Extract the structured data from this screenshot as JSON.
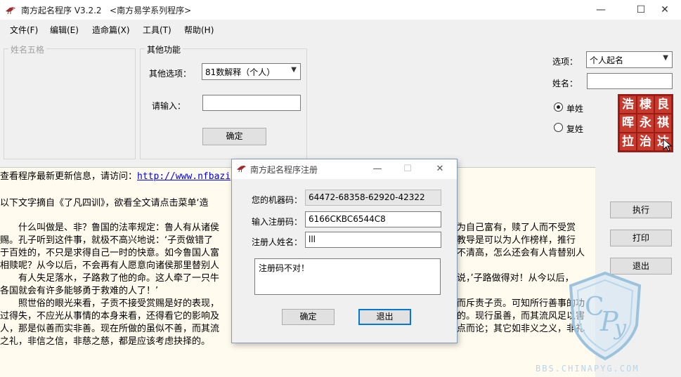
{
  "window": {
    "title": "南方起名程序 V3.2.2",
    "subtitle": "<南方易学系列程序>",
    "minimize": "—",
    "maximize": "☐",
    "close": "✕"
  },
  "menu": [
    "文件(F)",
    "编辑(E)",
    "造命篇(X)",
    "工具(T)",
    "帮助(H)"
  ],
  "name_five_grid": {
    "label": "姓名五格"
  },
  "other_functions": {
    "label": "其他功能",
    "option_label": "其他选项：",
    "option_value": "81数解释（个人）",
    "input_label": "请输入：",
    "input_value": "",
    "confirm": "确定"
  },
  "right_panel": {
    "option_label": "选项：",
    "option_value": "个人起名",
    "surname_label": "姓名：",
    "surname_value": "",
    "single_surname": "单姓",
    "compound_surname": "复姓",
    "single_checked": true,
    "seal_chars": [
      "浩",
      "棣",
      "良",
      "晖",
      "永",
      "祺",
      "拉",
      "治",
      "达"
    ],
    "run": "执行",
    "print": "打印",
    "exit": "退出"
  },
  "content": {
    "lines": [
      {
        "text": "查看程序最新更新信息，请访问：",
        "link": "http://www.nfbazi"
      },
      {
        "text": "以下文字摘自《了凡四训》，欲看全文请点击菜单‘造"
      },
      {
        "text": "　　什么叫做是、非？鲁国的法率规定：鲁人有从诸侯",
        "tail": "为自己富有，赎了人而不受赏"
      },
      {
        "text": "赐。孔子听到这件事，就极不高兴地说：‘子贡做错了",
        "tail": "教导是可以为人作榜样，推行"
      },
      {
        "text": "于百姓的，不只是求得自己一时的快意。如今鲁国人富",
        "tail": "不清高，怎么还会有人肯替别人"
      },
      {
        "text": "相赎呢？从今以后，不会再有人愿意向诸侯那里替别人"
      },
      {
        "text": "　　有人失足落水，子路救了他的命。这人牵了一只牛",
        "tail": "说，’子路做得对！从今以后，"
      },
      {
        "text": "各国就会有许多能够勇于救难的人了！’"
      },
      {
        "text": "　　照世俗的眼光来看，子贡不接受赏赐是好的表现，",
        "tail": "而斥责子贡。可知所行善事的功"
      },
      {
        "text": "过得失，不应光从事情的本身来看，还得看它的影响及",
        "tail": "的。现行虽善，而其流风足以害"
      },
      {
        "text": "人，那是似善而实非善。现在所做的虽似不善，而其流",
        "tail": "点而论；其它如非义之义，非礼"
      },
      {
        "text": "之礼，非信之信，非慈之慈，都是应该考虑抉择的。"
      }
    ]
  },
  "watermark": {
    "text": "BBS.CHINAPYG.COM",
    "logo_letters": "CPY"
  },
  "dialog": {
    "title": "南方起名程序注册",
    "machine_code_label": "您的机器码：",
    "machine_code": "64472-68358-62920-42322",
    "reg_code_label": "输入注册码：",
    "reg_code": "6166CKBC6544C8",
    "reg_name_label": "注册人姓名：",
    "reg_name": "lll",
    "message": "注册码不对！",
    "ok": "确定",
    "exit": "退出"
  },
  "colors": {
    "seal_dark": "#9b1c16",
    "seal_light": "#c63b2e",
    "text_area_bg": "#fffbef",
    "link": "#0000ee",
    "default_button_border": "#0078d7",
    "watermark": "#b8d6ea"
  },
  "icons": [
    "app-bird-icon",
    "minimize-icon",
    "maximize-icon",
    "close-icon",
    "chevron-down-icon",
    "cursor-arrow-icon"
  ]
}
